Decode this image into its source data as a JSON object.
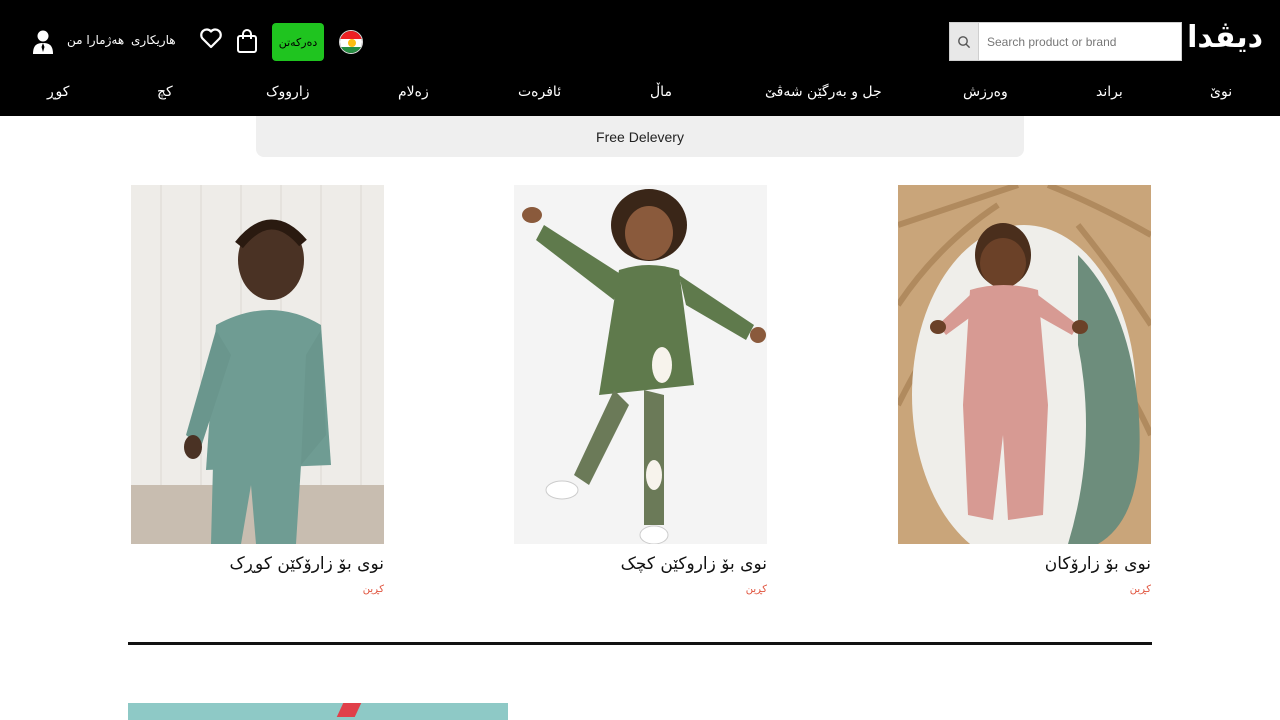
{
  "header": {
    "brand": "دیڤدا",
    "search_placeholder": "Search product or brand",
    "login_label": "دەرکەتن",
    "help_label": "هاریکاری",
    "account_label": "هەژمارا من",
    "language_flag": "kurdistan-flag"
  },
  "nav": {
    "items": [
      "نوێ",
      "براند",
      "وەرزش",
      "جل و بەرگێن شەڤێ",
      "ماڵ",
      "ئافرەت",
      "زەلام",
      "زارووک",
      "کچ",
      "کوڕ"
    ]
  },
  "promo": {
    "delivery_text": "Free Delevery"
  },
  "products": [
    {
      "title": "نوی بۆ زارۆکێن کوڕک",
      "shop_label": "کڕین"
    },
    {
      "title": "نوی بۆ زاروکێن کچک",
      "shop_label": "کڕین"
    },
    {
      "title": "نوی بۆ زارۆکان",
      "shop_label": "کڕین"
    }
  ],
  "colors": {
    "header_bg": "#000000",
    "login_button": "#1fc41f",
    "shop_link": "#e0533d",
    "delivery_bg": "#efefef"
  }
}
